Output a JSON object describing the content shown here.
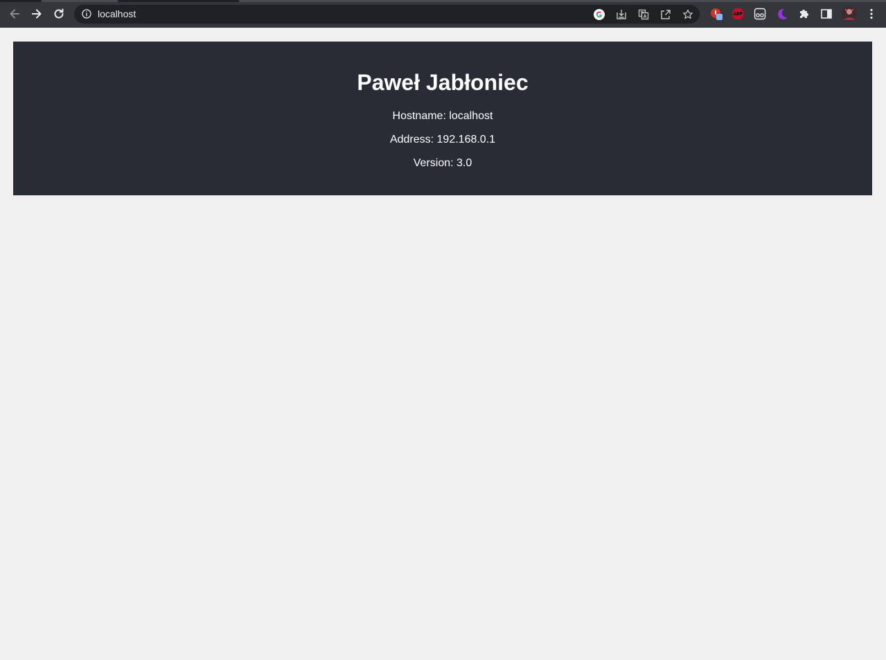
{
  "browser": {
    "url": "localhost",
    "icons": [
      "back-arrow-icon",
      "forward-arrow-icon",
      "reload-icon",
      "site-info-icon",
      "google-icon",
      "install-app-icon",
      "translate-icon",
      "share-icon",
      "bookmark-star-icon",
      "extension-red-icon",
      "adblock-plus-icon",
      "extension-glasses-icon",
      "dark-mode-moon-icon",
      "puzzle-extensions-icon",
      "side-panel-icon",
      "profile-avatar-icon",
      "menu-kebab-icon"
    ],
    "abp_label": "ABP"
  },
  "page": {
    "title": "Paweł Jabłoniec",
    "hostname": "Hostname: localhost",
    "address": "Address: 192.168.0.1",
    "version": "Version: 3.0"
  },
  "colors": {
    "page_background": "#f0f0f0",
    "banner_background": "#272c35",
    "banner_text": "#ffffff",
    "toolbar_background": "#35363a",
    "omnibox_background": "#202124"
  }
}
